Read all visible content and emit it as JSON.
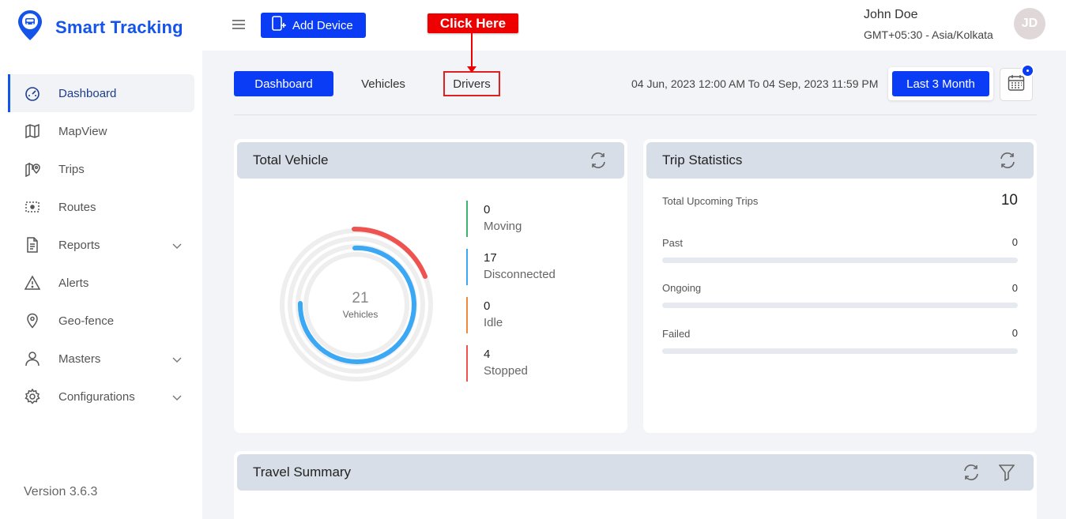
{
  "brand": {
    "name": "Smart Tracking"
  },
  "sidebar": {
    "items": [
      {
        "label": "Dashboard",
        "icon": "dashboard-icon",
        "active": true
      },
      {
        "label": "MapView",
        "icon": "map-icon"
      },
      {
        "label": "Trips",
        "icon": "trips-icon"
      },
      {
        "label": "Routes",
        "icon": "routes-icon"
      },
      {
        "label": "Reports",
        "icon": "reports-icon",
        "expandable": true
      },
      {
        "label": "Alerts",
        "icon": "alert-icon"
      },
      {
        "label": "Geo-fence",
        "icon": "location-pin-icon"
      },
      {
        "label": "Masters",
        "icon": "user-icon",
        "expandable": true
      },
      {
        "label": "Configurations",
        "icon": "gear-icon",
        "expandable": true
      }
    ],
    "version": "Version 3.6.3"
  },
  "topbar": {
    "add_device_label": "Add Device",
    "user_name": "John Doe",
    "user_timezone": "GMT+05:30 - Asia/Kolkata",
    "avatar_initials": "JD"
  },
  "callout": {
    "text": "Click Here",
    "color": "#ee0000"
  },
  "tabs": [
    {
      "label": "Dashboard",
      "active": true
    },
    {
      "label": "Vehicles"
    },
    {
      "label": "Drivers",
      "highlighted": true
    }
  ],
  "filter": {
    "date_range": "04 Jun, 2023 12:00 AM To 04 Sep, 2023 11:59 PM",
    "preset_label": "Last 3 Month"
  },
  "total_vehicle": {
    "title": "Total Vehicle",
    "total": "21",
    "total_label": "Vehicles",
    "statuses": [
      {
        "value": "0",
        "label": "Moving",
        "color": "#3cb371"
      },
      {
        "value": "17",
        "label": "Disconnected",
        "color": "#3aa8f5"
      },
      {
        "value": "0",
        "label": "Idle",
        "color": "#f08a3c"
      },
      {
        "value": "4",
        "label": "Stopped",
        "color": "#ef5350"
      }
    ]
  },
  "trip_statistics": {
    "title": "Trip Statistics",
    "upcoming_label": "Total Upcoming Trips",
    "upcoming_value": "10",
    "rows": [
      {
        "label": "Past",
        "value": "0",
        "fraction": 0
      },
      {
        "label": "Ongoing",
        "value": "0",
        "fraction": 0
      },
      {
        "label": "Failed",
        "value": "0",
        "fraction": 0
      }
    ]
  },
  "travel_summary": {
    "title": "Travel Summary"
  },
  "colors": {
    "primary": "#0a3cf5",
    "brand_text": "#1454e8",
    "card_header": "#d7dee7"
  }
}
